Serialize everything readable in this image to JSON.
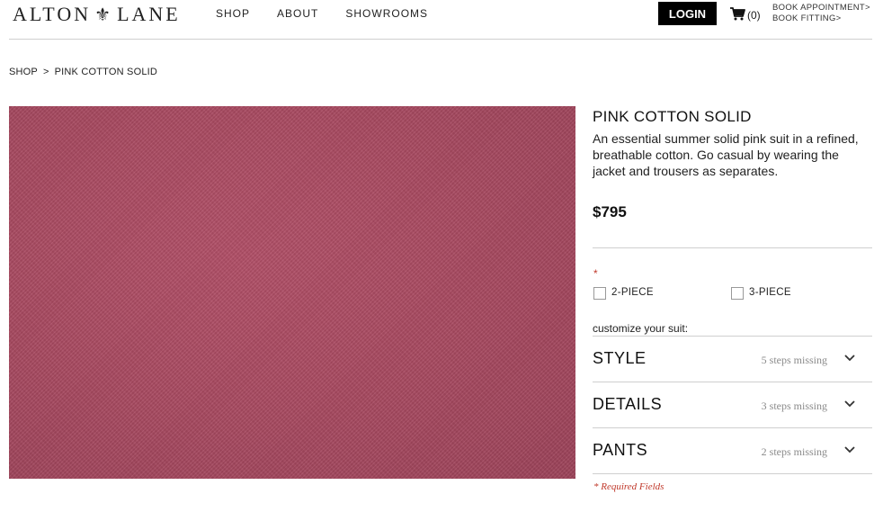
{
  "header": {
    "logo_left": "ALTON",
    "logo_mark": "⚜",
    "logo_right": "LANE",
    "nav": [
      "SHOP",
      "ABOUT",
      "SHOWROOMS"
    ],
    "login_label": "LOGIN",
    "cart_count": "(0)",
    "book_appointment": "BOOK APPOINTMENT",
    "book_fitting": "BOOK FITTING",
    "link_arrow": ">"
  },
  "breadcrumb": {
    "shop": "SHOP",
    "sep": ">",
    "current": "PINK COTTON SOLID"
  },
  "product": {
    "title": "PINK COTTON SOLID",
    "description": "An essential summer solid pink suit in a refined, breathable cotton. Go casual by wearing the jacket and trousers as separates.",
    "price": "$795",
    "required_star": "*",
    "options": [
      "2-PIECE",
      "3-PIECE"
    ],
    "customize_label": "customize your suit:",
    "accordions": [
      {
        "label": "STYLE",
        "status": "5 steps missing"
      },
      {
        "label": "DETAILS",
        "status": "3 steps missing"
      },
      {
        "label": "PANTS",
        "status": "2 steps missing"
      }
    ],
    "required_note": "* Required Fields"
  },
  "colors": {
    "fabric": "#a94a61",
    "required": "#c0392b",
    "login_bg": "#000000"
  },
  "icons": [
    "cart-icon",
    "chevron-down-icon"
  ]
}
